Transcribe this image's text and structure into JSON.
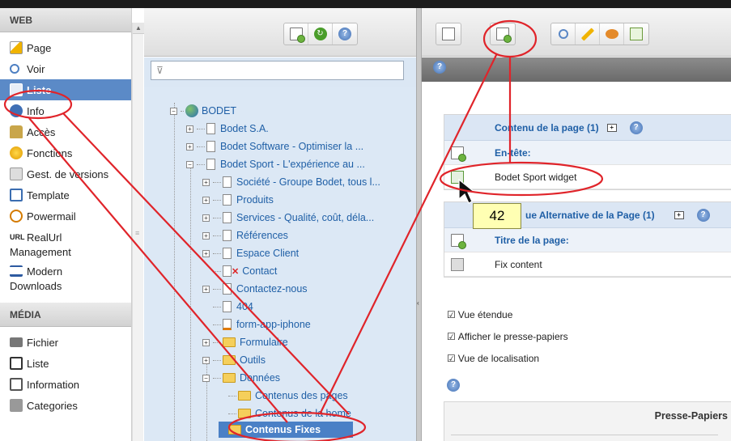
{
  "module_menu": {
    "web_header": "WEB",
    "web_items": [
      {
        "label": "Page",
        "icon": "page-edit-icon"
      },
      {
        "label": "Voir",
        "icon": "view-icon"
      },
      {
        "label": "Liste",
        "icon": "list-icon",
        "active": true
      },
      {
        "label": "Info",
        "icon": "info-icon"
      },
      {
        "label": "Accès",
        "icon": "access-icon"
      },
      {
        "label": "Fonctions",
        "icon": "functions-icon"
      },
      {
        "label": "Gest. de versions",
        "icon": "versions-icon"
      },
      {
        "label": "Template",
        "icon": "template-icon"
      },
      {
        "label": "Powermail",
        "icon": "powermail-icon"
      },
      {
        "label": "RealUrl",
        "label2": "Management",
        "icon": "realurl-icon"
      },
      {
        "label": "Modern",
        "label2": "Downloads",
        "icon": "downloads-icon"
      }
    ],
    "media_header": "MÉDIA",
    "media_items": [
      {
        "label": "Fichier",
        "icon": "folder-icon"
      },
      {
        "label": "Liste",
        "icon": "list-icon"
      },
      {
        "label": "Information",
        "icon": "information-icon"
      },
      {
        "label": "Categories",
        "icon": "categories-icon"
      }
    ],
    "realurl_badge": "URL"
  },
  "tree": {
    "filter_placeholder": "",
    "nodes": [
      {
        "label": "BODET"
      },
      {
        "label": "Bodet S.A."
      },
      {
        "label": "Bodet Software - Optimiser la ..."
      },
      {
        "label": "Bodet Sport - L'expérience au ..."
      },
      {
        "label": "Société - Groupe Bodet, tous l..."
      },
      {
        "label": "Produits"
      },
      {
        "label": "Services - Qualité, coût, déla..."
      },
      {
        "label": "Références"
      },
      {
        "label": "Espace Client"
      },
      {
        "label": "Contact"
      },
      {
        "label": "Contactez-nous"
      },
      {
        "label": "404"
      },
      {
        "label": "form-app-iphone"
      },
      {
        "label": "Formulaire"
      },
      {
        "label": "Outils"
      },
      {
        "label": "Données"
      },
      {
        "label": "Contenus des pages"
      },
      {
        "label": "Contenus de la home"
      },
      {
        "label": "Contenus Fixes"
      }
    ]
  },
  "content": {
    "panel1": {
      "header": "Contenu de la page (1)",
      "sub": "En-tête:",
      "row": "Bodet Sport widget"
    },
    "panel2": {
      "header": "ue Alternative de la Page (1)",
      "sub": "Titre de la page:",
      "row": "Fix content"
    },
    "options": [
      {
        "label": "Vue étendue",
        "checked": true
      },
      {
        "label": "Afficher le presse-papiers",
        "checked": true
      },
      {
        "label": "Vue de localisation",
        "checked": true
      }
    ],
    "clipboard_header": "Presse-Papiers"
  },
  "tooltip": "42",
  "colors": {
    "accent": "#5b8ac7",
    "tree_bg": "#dce8f5",
    "annotation": "#e0242a"
  }
}
